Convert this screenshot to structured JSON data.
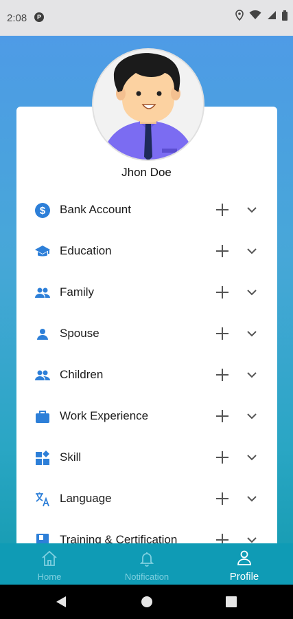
{
  "status_bar": {
    "time": "2:08",
    "app_icon_letter": "P"
  },
  "profile": {
    "name": "Jhon Doe"
  },
  "sections": [
    {
      "label": "Bank Account",
      "icon": "bank-account-icon"
    },
    {
      "label": "Education",
      "icon": "education-icon"
    },
    {
      "label": "Family",
      "icon": "family-icon"
    },
    {
      "label": "Spouse",
      "icon": "spouse-icon"
    },
    {
      "label": "Children",
      "icon": "children-icon"
    },
    {
      "label": "Work Experience",
      "icon": "work-experience-icon"
    },
    {
      "label": "Skill",
      "icon": "skill-icon"
    },
    {
      "label": "Language",
      "icon": "language-icon"
    },
    {
      "label": "Training & Certification",
      "icon": "training-icon"
    }
  ],
  "bottom_nav": {
    "home": "Home",
    "notification": "Notification",
    "profile": "Profile"
  },
  "colors": {
    "accent_icon": "#2d7fd8",
    "nav_bg": "#0f9bb5",
    "gradient_top": "#4e9be6",
    "gradient_bottom": "#129aae"
  }
}
